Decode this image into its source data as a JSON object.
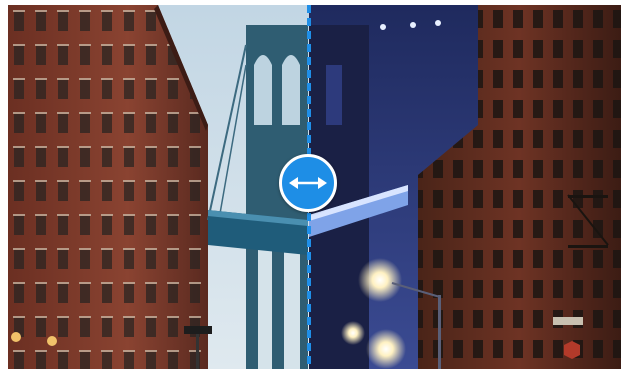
{
  "comparison": {
    "before_label": "",
    "after_label": "",
    "split_position_percent": 49,
    "handle_icon": "double-arrow-horizontal-icon",
    "accent_color": "#1e8ee6",
    "day_sky_color": "#c9dbe7",
    "night_sky_color": "#2a3670"
  },
  "scene": {
    "street_sign_text": "",
    "stop_sign_text": ""
  }
}
